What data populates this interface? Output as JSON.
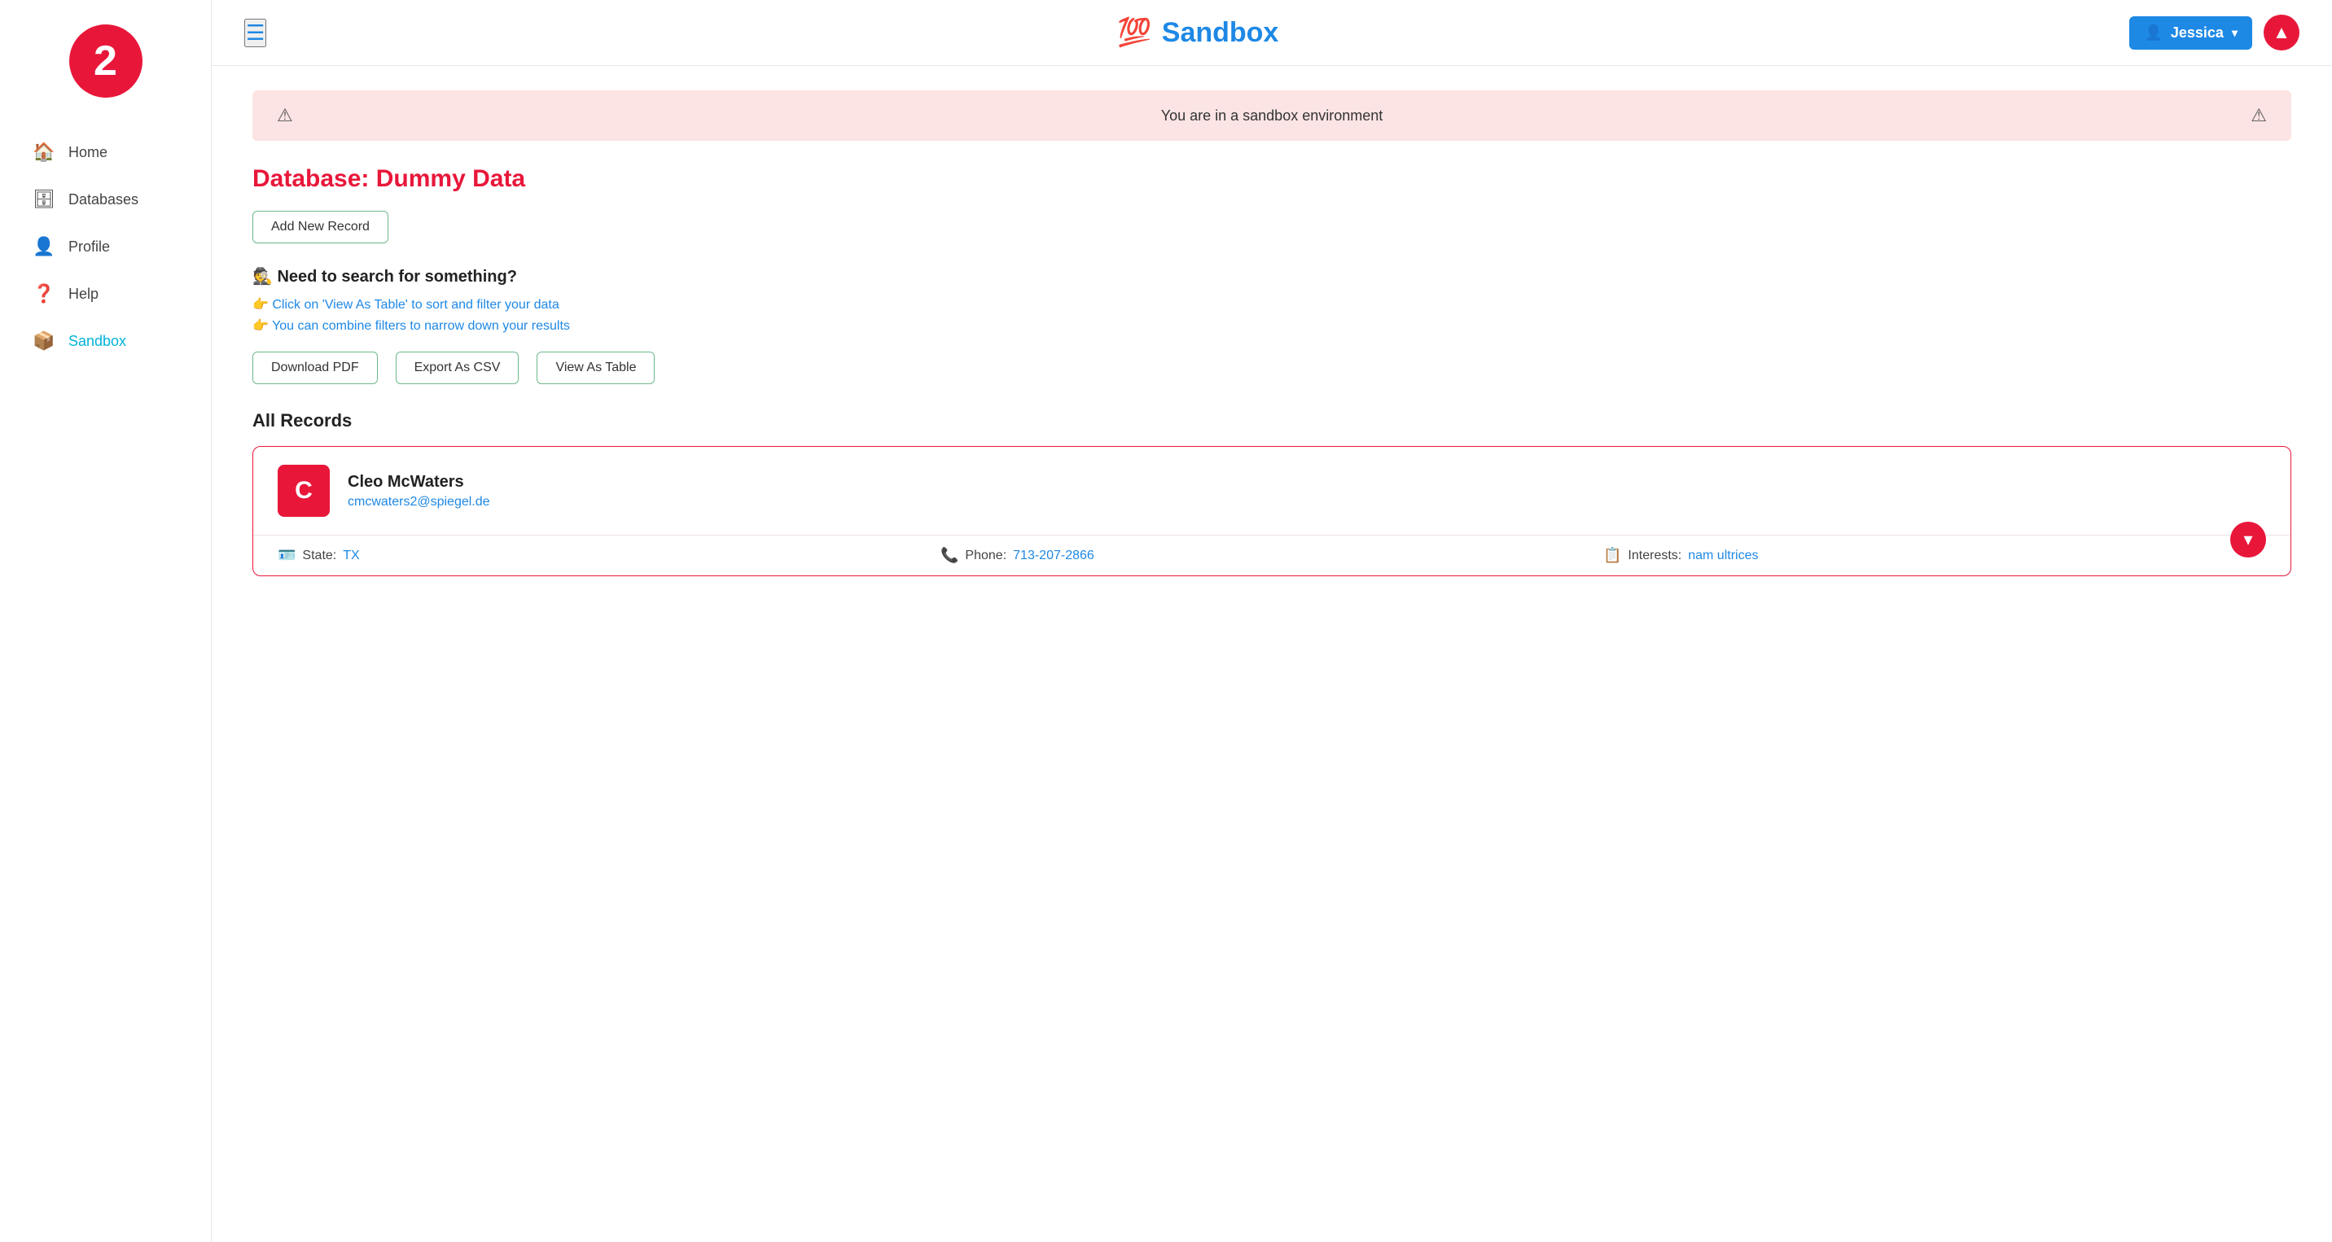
{
  "sidebar": {
    "logo_number": "2",
    "nav_items": [
      {
        "id": "home",
        "label": "Home",
        "icon": "🏠",
        "active": false
      },
      {
        "id": "databases",
        "label": "Databases",
        "icon": "🗄",
        "active": false
      },
      {
        "id": "profile",
        "label": "Profile",
        "icon": "👤",
        "active": false
      },
      {
        "id": "help",
        "label": "Help",
        "icon": "❓",
        "active": false
      },
      {
        "id": "sandbox",
        "label": "Sandbox",
        "icon": "📦",
        "active": true
      }
    ]
  },
  "header": {
    "hamburger_label": "☰",
    "title": "Sandbox",
    "title_emoji": "💯",
    "user_name": "Jessica",
    "user_icon": "👤",
    "scroll_top_icon": "▲"
  },
  "banner": {
    "text": "You are in a sandbox environment",
    "warn_icon_left": "⚠",
    "warn_icon_right": "⚠"
  },
  "page": {
    "db_title": "Database: Dummy Data",
    "add_record_btn": "Add New Record",
    "search_section": {
      "title": "🕵 Need to search for something?",
      "hint1": "👉 Click on 'View As Table' to sort and filter your data",
      "hint2": "👉 You can combine filters to narrow down your results"
    },
    "action_buttons": {
      "download_pdf": "Download PDF",
      "export_csv": "Export As CSV",
      "view_table": "View As Table"
    },
    "all_records_title": "All Records",
    "record": {
      "avatar_letter": "C",
      "name": "Cleo McWaters",
      "email": "cmcwaters2@spiegel.de",
      "state_label": "State:",
      "state_value": "TX",
      "phone_label": "Phone:",
      "phone_value": "713-207-2866",
      "interests_label": "Interests:",
      "interests_value": "nam ultrices"
    }
  },
  "colors": {
    "red": "#e8173a",
    "blue": "#1e88e5",
    "teal": "#00b4d8",
    "green_border": "#6cb98a",
    "banner_bg": "#fce4e4"
  }
}
